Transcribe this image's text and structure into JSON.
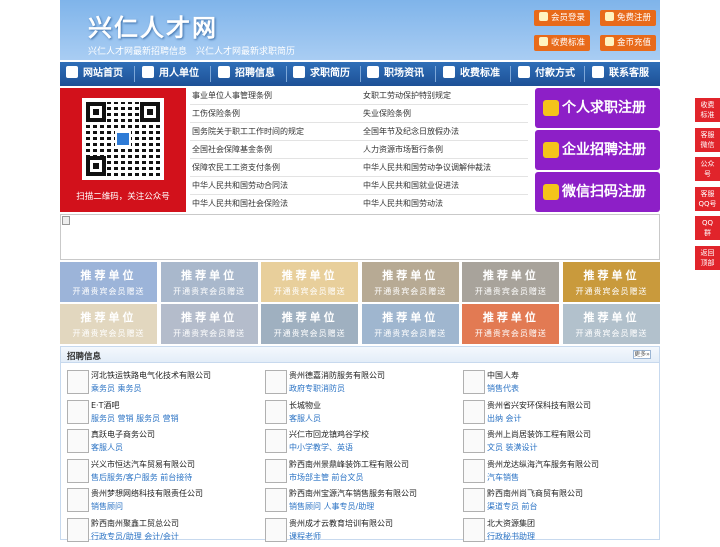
{
  "header": {
    "site_name": "兴仁人才网",
    "slogan": "兴仁人才网最新招聘信息　兴仁人才网最新求职简历",
    "buttons": {
      "member_login": "会员登录",
      "free_register": "免费注册",
      "fee_standard": "收费标准",
      "gold_recharge": "金币充值"
    }
  },
  "nav": {
    "items": [
      "网站首页",
      "用人单位",
      "招聘信息",
      "求职简历",
      "职场资讯",
      "收费标准",
      "付款方式",
      "联系客服"
    ]
  },
  "qr": {
    "caption": "扫描二维码，关注公众号"
  },
  "policy_links": {
    "left": [
      "事业单位人事管理条例",
      "工伤保险条例",
      "国务院关于职工工作时间的规定",
      "全国社会保障基金条例",
      "保障农民工工资支付条例",
      "中华人民共和国劳动合同法",
      "中华人民共和国社会保险法"
    ],
    "right": [
      "女职工劳动保护特别规定",
      "失业保险条例",
      "全国年节及纪念日放假办法",
      "人力资源市场暂行条例",
      "中华人民共和国劳动争议调解仲裁法",
      "中华人民共和国就业促进法",
      "中华人民共和国劳动法"
    ]
  },
  "register": {
    "personal": "个人求职注册",
    "company": "企业招聘注册",
    "wechat": "微信扫码注册"
  },
  "recommend": {
    "title": "推荐单位",
    "subtitle": "开通贵宾会员赠送",
    "colors": [
      "#9cb4d9",
      "#a9b8cc",
      "#e8cf9b",
      "#b7aa94",
      "#a8a39b",
      "#c99a3c",
      "#e2d7bf",
      "#b4bccb",
      "#9fb0c0",
      "#9fb6cf",
      "#e27a53",
      "#b2c1cc"
    ]
  },
  "jobs": {
    "title": "招聘信息",
    "more": "更多»",
    "columns": [
      [
        {
          "company": "河北铁运铁路电气化技术有限公司",
          "positions": "乘务员 乘务员"
        },
        {
          "company": "E·T酒吧",
          "positions": "服务员 营销 服务员 营销"
        },
        {
          "company": "真跃电子商务公司",
          "positions": "客服人员"
        },
        {
          "company": "兴义市恒达汽车贸易有限公司",
          "positions": "售后服务/客户服务 前台接待"
        },
        {
          "company": "贵州梦想网络科技有限责任公司",
          "positions": "销售顾问"
        },
        {
          "company": "黔西南州聚鑫工贸总公司",
          "positions": "行政专员/助理 会计/会计"
        }
      ],
      [
        {
          "company": "贵州德嘉消防服务有限公司",
          "positions": "政府专职消防员"
        },
        {
          "company": "长城物业",
          "positions": "客服人员"
        },
        {
          "company": "兴仁市回龙镇鸡谷学校",
          "positions": "中小学教学、英语"
        },
        {
          "company": "黔西南州景鼎峰装饰工程有限公司",
          "positions": "市场部主管 前台文员"
        },
        {
          "company": "黔西南州宝源汽车销售服务有限公司",
          "positions": "销售顾问 人事专员/助理"
        },
        {
          "company": "贵州成才云教育培训有限公司",
          "positions": "课程老师"
        }
      ],
      [
        {
          "company": "中国人寿",
          "positions": "销售代表"
        },
        {
          "company": "贵州省兴安环保科技有限公司",
          "positions": "出纳 会计"
        },
        {
          "company": "贵州上尚居装饰工程有限公司",
          "positions": "文员 装潢设计"
        },
        {
          "company": "贵州龙达纵海汽车服务有限公司",
          "positions": "汽车销售"
        },
        {
          "company": "黔西南州尚飞商贸有限公司",
          "positions": "渠道专员 前台"
        },
        {
          "company": "北大资源集团",
          "positions": "行政秘书助理"
        }
      ]
    ]
  },
  "side_float": {
    "items": [
      "收费\n标准",
      "客服\n微信",
      "公众\n号",
      "客服\nQQ号",
      "QQ\n群",
      "返回\n顶部"
    ]
  }
}
